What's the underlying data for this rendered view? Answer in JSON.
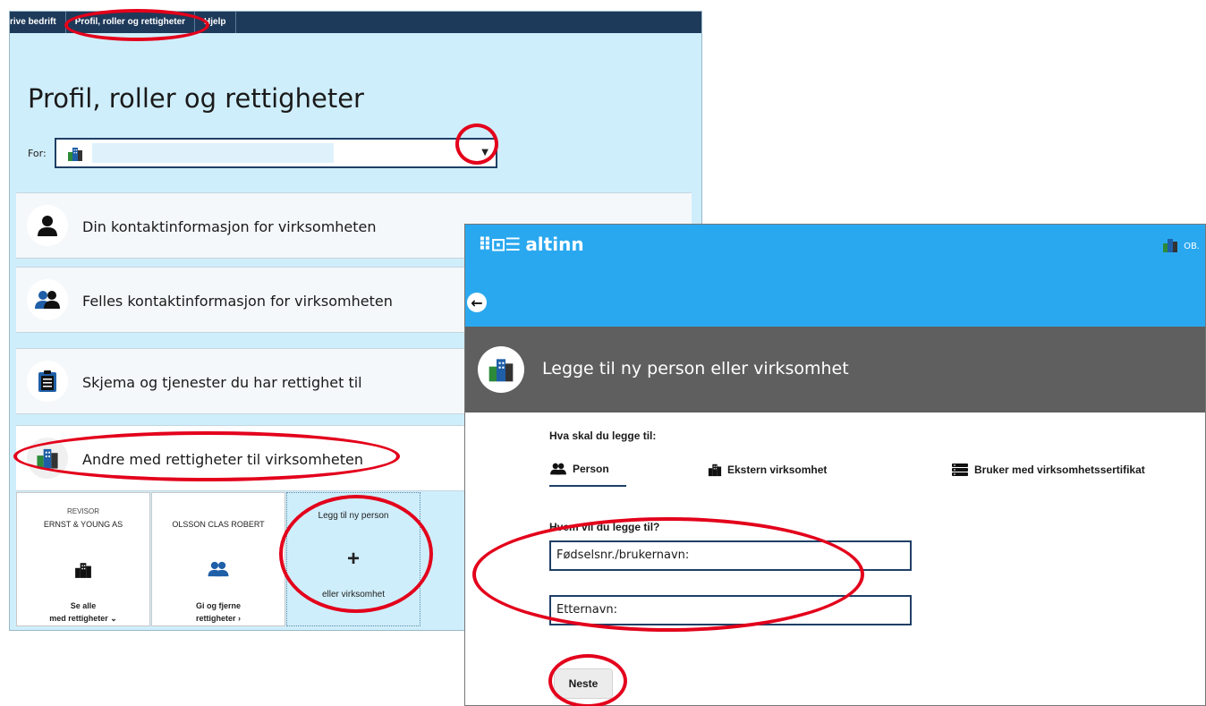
{
  "left": {
    "topbar": {
      "tabs": [
        "rive bedrift",
        "Profil, roller og rettigheter",
        "Hjelp"
      ]
    },
    "title": "Profil, roller og rettigheter",
    "for_label": "For:",
    "items": [
      {
        "label": "Din kontaktinformasjon for virksomheten",
        "icon": "person-icon"
      },
      {
        "label": "Felles kontaktinformasjon for virksomheten",
        "icon": "group-icon"
      },
      {
        "label": "Skjema og tjenester du har rettighet til",
        "icon": "clipboard-icon"
      },
      {
        "label": "Andre med rettigheter til virksomheten",
        "icon": "buildings-icon"
      }
    ],
    "cards": [
      {
        "role": "REVISOR",
        "name": "ERNST & YOUNG AS",
        "link1": "Se alle",
        "link2": "med rettigheter ⌄",
        "icon": "buildings-icon"
      },
      {
        "name": "OLSSON CLAS ROBERT",
        "link1": "Gi og fjerne",
        "link2": "rettigheter ›",
        "icon": "group-icon"
      },
      {
        "line1": "Legg til ny person",
        "plus": "+",
        "line2": "eller virksomhet"
      }
    ]
  },
  "right": {
    "logo_text": "altinn",
    "user_text": "OB.",
    "back_label": "←",
    "title": "Legge til ny person eller virksomhet",
    "question1": "Hva skal du legge til:",
    "options": [
      {
        "label": "Person",
        "icon": "group-icon"
      },
      {
        "label": "Ekstern virksomhet",
        "icon": "buildings-icon"
      },
      {
        "label": "Bruker med virksomhetssertifikat",
        "icon": "server-icon"
      }
    ],
    "question2": "Hvem vil du legge til?",
    "field1_label": "Fødselsnr./brukernavn:",
    "field2_label": "Etternavn:",
    "next_button": "Neste"
  },
  "colors": {
    "header_blue": "#2aa8ef",
    "nav_dark": "#1e3a5a",
    "panel_light_blue": "#cfeefb",
    "annotation_red": "#e3001b"
  }
}
